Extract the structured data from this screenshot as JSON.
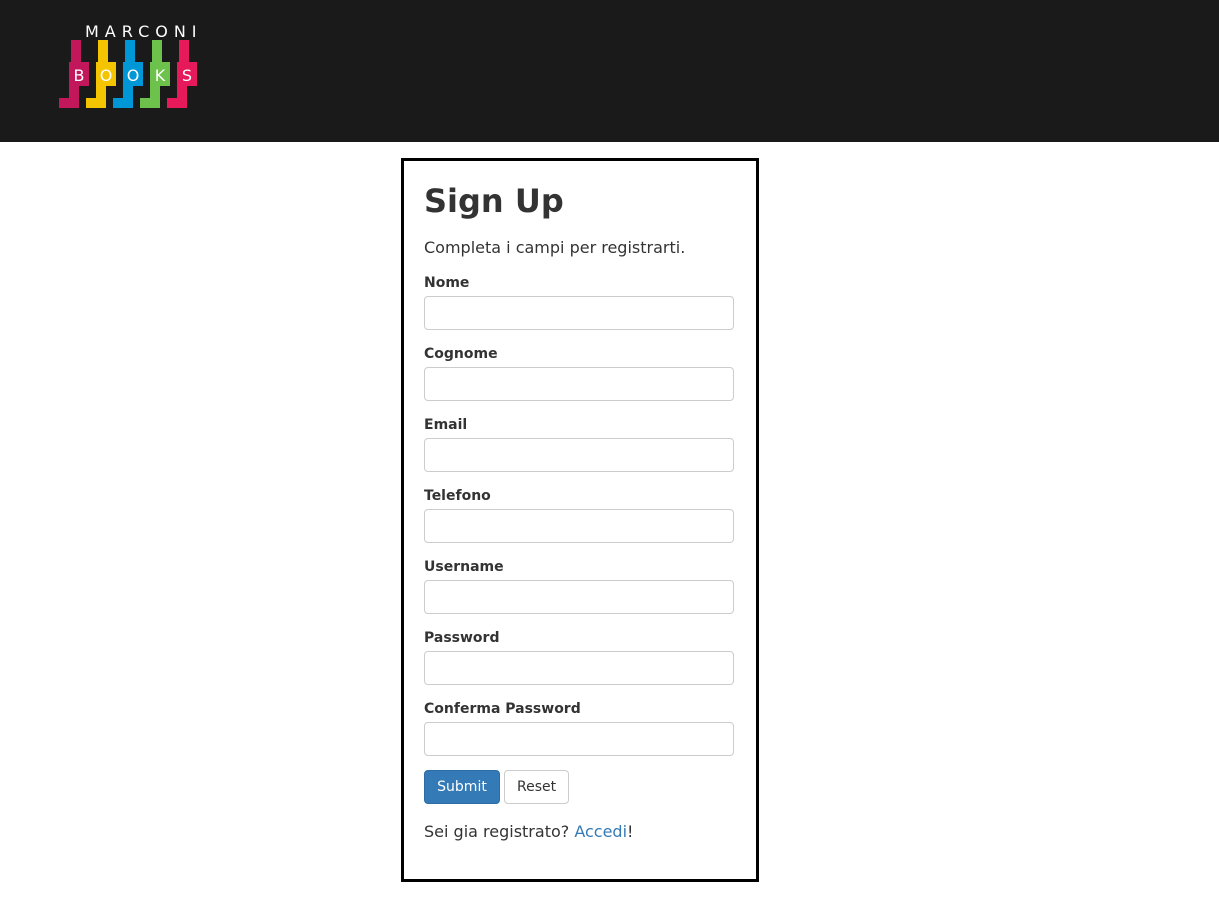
{
  "header": {
    "logo": {
      "top_text": "MARCONI",
      "letters": [
        "B",
        "O",
        "O",
        "K",
        "S"
      ],
      "colors": [
        "#c2185b",
        "#f5c400",
        "#0097d6",
        "#6cc24a",
        "#e6195a"
      ]
    },
    "background": "#1a1a1a"
  },
  "form": {
    "title": "Sign Up",
    "subtitle": "Completa i campi per registrarti.",
    "fields": [
      {
        "label": "Nome",
        "value": "",
        "placeholder": ""
      },
      {
        "label": "Cognome",
        "value": "",
        "placeholder": ""
      },
      {
        "label": "Email",
        "value": "",
        "placeholder": ""
      },
      {
        "label": "Telefono",
        "value": "",
        "placeholder": ""
      },
      {
        "label": "Username",
        "value": "",
        "placeholder": ""
      },
      {
        "label": "Password",
        "value": "",
        "placeholder": ""
      },
      {
        "label": "Conferma Password",
        "value": "",
        "placeholder": ""
      }
    ],
    "submit_label": "Submit",
    "reset_label": "Reset",
    "footer_prefix": "Sei gia registrato? ",
    "footer_link": "Accedi",
    "footer_suffix": "!"
  },
  "colors": {
    "primary": "#337ab7",
    "text": "#333333",
    "border": "#cccccc"
  }
}
